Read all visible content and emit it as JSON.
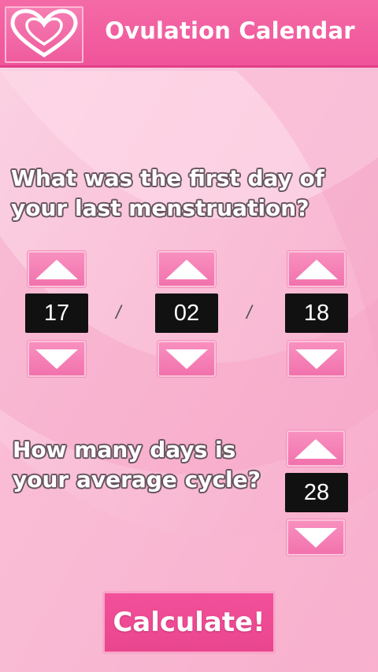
{
  "header": {
    "title": "Ovulation Calendar",
    "logo_icon": "heart-icon"
  },
  "question_first_day": {
    "line1": "What was the first day of",
    "line2": "your last menstruation?"
  },
  "date": {
    "day": "17",
    "month": "02",
    "year": "18",
    "separator": "/"
  },
  "question_cycle": {
    "line1": "How many days is",
    "line2": "your average cycle?"
  },
  "cycle": {
    "days": "28"
  },
  "calculate_label": "Calculate!",
  "icons": {
    "up": "triangle-up-icon",
    "down": "triangle-down-icon"
  },
  "colors": {
    "header": "#f0549a",
    "background": "#f9bcd5",
    "button": "#f272ad",
    "value_box": "#111111"
  }
}
